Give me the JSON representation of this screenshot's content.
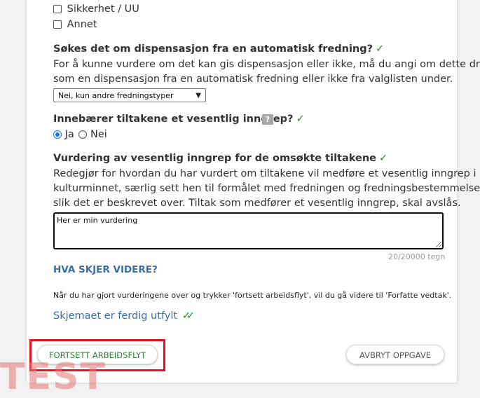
{
  "checkboxes": [
    {
      "label": "Sikkerhet / UU",
      "checked": false
    },
    {
      "label": "Annet",
      "checked": false
    }
  ],
  "dispensation": {
    "question": "Søkes det om dispensasjon fra en automatisk fredning?",
    "check": "✓",
    "help_line1": "For å kunne vurdere om det kan gis dispensasjon eller ikke, må du angi om dette dreier",
    "help_line2": "som en dispensasjon fra en automatisk fredning eller ikke fra valglisten under.",
    "selected_option": "Nei, kun andre fredningstyper"
  },
  "intervention": {
    "question": "Innebærer tiltakene et vesentlig inngrep?",
    "check": "✓",
    "help_icon": "?",
    "options": [
      {
        "label": "Ja",
        "selected": true
      },
      {
        "label": "Nei",
        "selected": false
      }
    ]
  },
  "assessment": {
    "question": "Vurdering av vesentlig inngrep for de omsøkte tiltakene",
    "check": "✓",
    "help_line1": "Redegjør for hvordan du har vurdert om tiltakene vil medføre et vesentlig inngrep i",
    "help_line2": "kulturminnet, særlig sett hen til formålet med fredningen og fredningsbestemmelsene,",
    "help_line3": "slik det er beskrevet over. Tiltak som medfører et vesentlig inngrep, skal avslås.",
    "value": "Her er min vurdering",
    "counter": "20/20000 tegn"
  },
  "next": {
    "heading": "HVA SKJER VIDERE?",
    "text": "Når du har gjort vurderingene over og trykker 'fortsett arbeidsflyt', vil du gå videre til 'Forfatte vedtak'.",
    "complete_label": "Skjemaet er ferdig utfylt",
    "complete_icon": "✓✓"
  },
  "buttons": {
    "continue": "FORTSETT ARBEIDSFLYT",
    "cancel": "AVBRYT OPPGAVE"
  },
  "watermark": "TEST",
  "colors": {
    "accent_blue": "#3a6fa8",
    "check_green": "#2e8b2e",
    "highlight_red": "#e0141e"
  }
}
